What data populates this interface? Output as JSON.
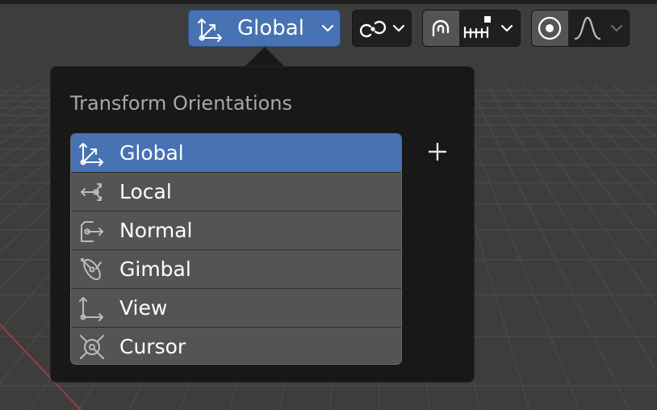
{
  "header": {
    "orientation": {
      "label": "Global",
      "icon": "orientation-global-icon"
    },
    "pivot": {
      "icon": "pivot-link-icon"
    },
    "snap": {
      "icon": "snap-magnet-icon",
      "element_icon": "snap-increment-icon",
      "active": true
    },
    "proportional_edit": {
      "icon": "proportional-edit-icon",
      "falloff_icon": "falloff-smooth-curve-icon",
      "active": true
    }
  },
  "popover": {
    "title": "Transform Orientations",
    "add_icon": "plus-icon",
    "items": [
      {
        "label": "Global",
        "icon": "orientation-global-icon",
        "selected": true
      },
      {
        "label": "Local",
        "icon": "orientation-local-icon",
        "selected": false
      },
      {
        "label": "Normal",
        "icon": "orientation-normal-icon",
        "selected": false
      },
      {
        "label": "Gimbal",
        "icon": "orientation-gimbal-icon",
        "selected": false
      },
      {
        "label": "View",
        "icon": "orientation-view-icon",
        "selected": false
      },
      {
        "label": "Cursor",
        "icon": "orientation-cursor-icon",
        "selected": false
      }
    ]
  },
  "colors": {
    "accent": "#4772b3",
    "popover_bg": "#181818",
    "row_bg": "#545454",
    "viewport_bg": "#3d3d3d",
    "grid_line": "#4a4a4a",
    "x_axis": "#a33a3a"
  }
}
